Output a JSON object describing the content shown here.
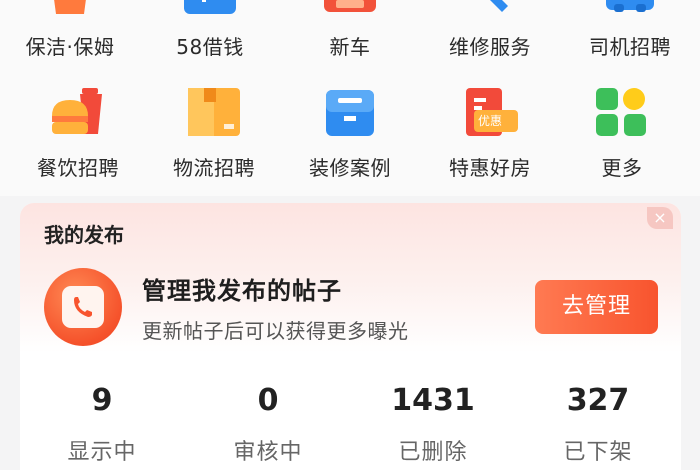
{
  "services": {
    "row1": [
      {
        "label": "保洁·保姆",
        "icon": "basket-icon"
      },
      {
        "label": "58借钱",
        "icon": "loan-icon"
      },
      {
        "label": "新车",
        "icon": "car-icon"
      },
      {
        "label": "维修服务",
        "icon": "tools-icon"
      },
      {
        "label": "司机招聘",
        "icon": "truck-icon"
      }
    ],
    "row2": [
      {
        "label": "餐饮招聘",
        "icon": "burger-drink-icon"
      },
      {
        "label": "物流招聘",
        "icon": "package-icon"
      },
      {
        "label": "装修案例",
        "icon": "toolbox-icon"
      },
      {
        "label": "特惠好房",
        "icon": "house-deal-icon",
        "badge": "优惠"
      },
      {
        "label": "更多",
        "icon": "more-grid-icon"
      }
    ]
  },
  "publish": {
    "title": "我的发布",
    "close": "×",
    "manage_title": "管理我发布的帖子",
    "manage_subtitle": "更新帖子后可以获得更多曝光",
    "manage_button": "去管理",
    "stats": [
      {
        "value": "9",
        "label": "显示中"
      },
      {
        "value": "0",
        "label": "审核中"
      },
      {
        "value": "1431",
        "label": "已删除"
      },
      {
        "value": "327",
        "label": "已下架"
      }
    ]
  },
  "colors": {
    "accent": "#f8542e",
    "card_gradient_top": "#fde4e1"
  }
}
